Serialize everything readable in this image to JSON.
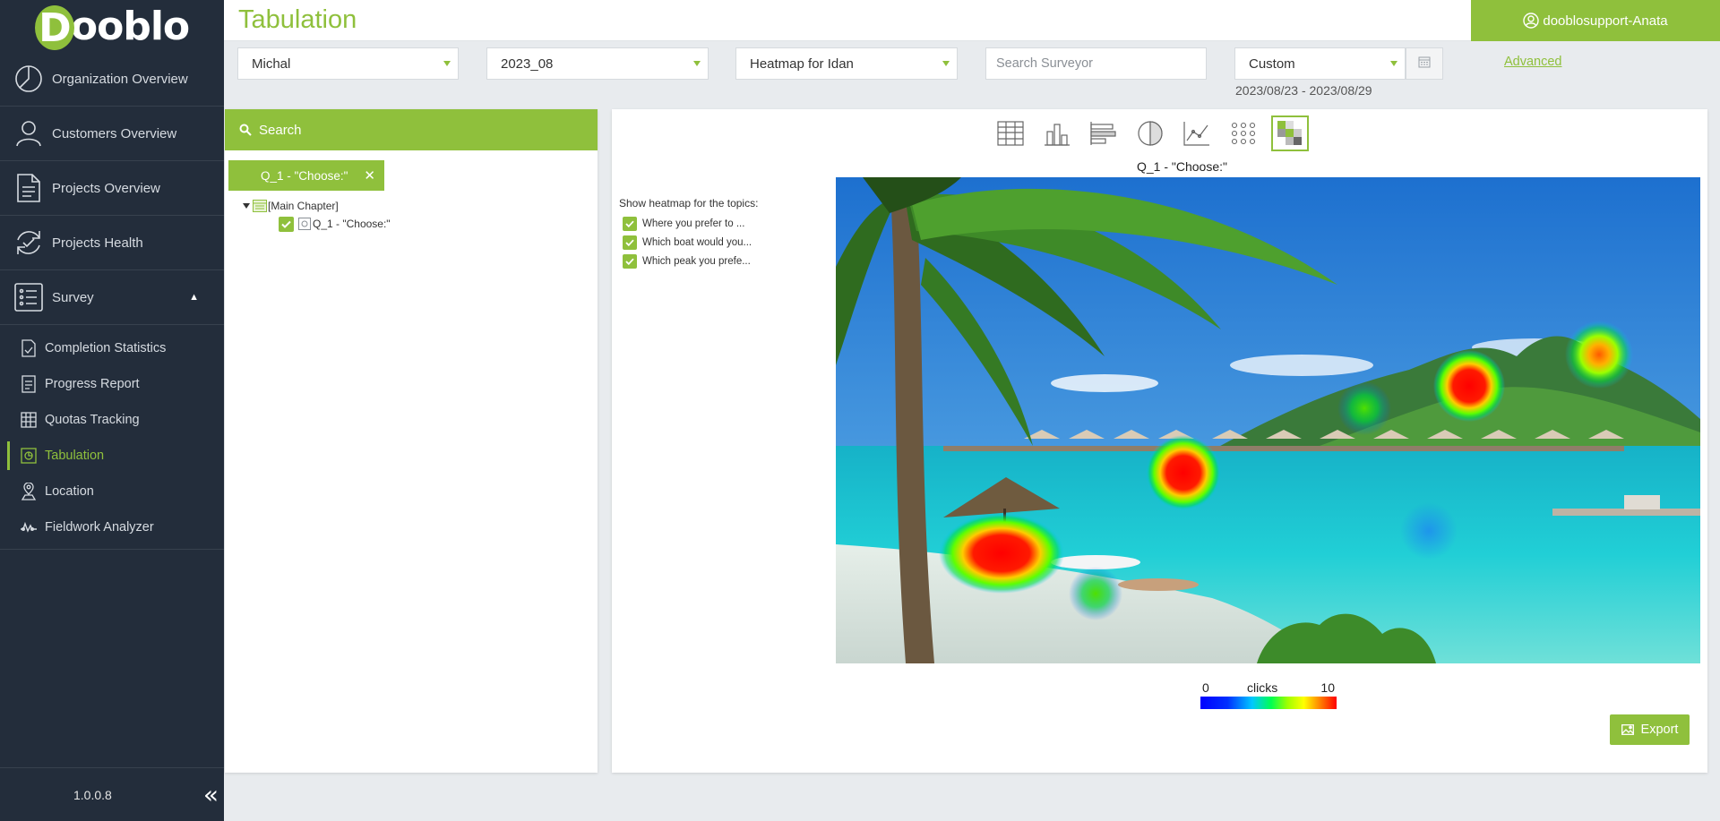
{
  "app": {
    "logo_text": "ooblo",
    "logo_letter": "D",
    "version": "1.0.0.8"
  },
  "sidebar": {
    "main_items": [
      {
        "label": "Organization Overview",
        "icon": "pie-chart-icon"
      },
      {
        "label": "Customers Overview",
        "icon": "user-icon"
      },
      {
        "label": "Projects Overview",
        "icon": "document-icon"
      },
      {
        "label": "Projects Health",
        "icon": "refresh-icon"
      },
      {
        "label": "Survey",
        "icon": "list-icon"
      }
    ],
    "sub_items": [
      {
        "label": "Completion Statistics",
        "icon": "checklist-icon"
      },
      {
        "label": "Progress Report",
        "icon": "report-icon"
      },
      {
        "label": "Quotas Tracking",
        "icon": "grid-icon"
      },
      {
        "label": "Tabulation",
        "icon": "tabulation-icon",
        "active": true
      },
      {
        "label": "Location",
        "icon": "location-icon"
      },
      {
        "label": "Fieldwork Analyzer",
        "icon": "wave-icon"
      }
    ]
  },
  "header": {
    "title": "Tabulation",
    "user": "dooblosupport-Anata"
  },
  "filters": {
    "customer": "Michal",
    "project": "2023_08",
    "report": "Heatmap for Idan",
    "surveyor_placeholder": "Search Surveyor",
    "period": "Custom",
    "date_range": "2023/08/23 - 2023/08/29",
    "advanced": "Advanced"
  },
  "left_panel": {
    "search_label": "Search",
    "chip_label": "Q_1 - \"Choose:\"",
    "chip_remove": "✕",
    "tree_root": "[Main Chapter]",
    "tree_child": "Q_1 - \"Choose:\""
  },
  "main_panel": {
    "chart_title": "Q_1 - \"Choose:\"",
    "topics_label": "Show heatmap for the topics:",
    "topics": [
      "Where you prefer to ...",
      "Which boat would you...",
      "Which peak you prefe..."
    ],
    "legend": {
      "min": "0",
      "label": "clicks",
      "max": "10"
    },
    "export_label": "Export"
  },
  "colors": {
    "accent": "#8fc03c",
    "sidebar_bg": "#232d3b"
  }
}
